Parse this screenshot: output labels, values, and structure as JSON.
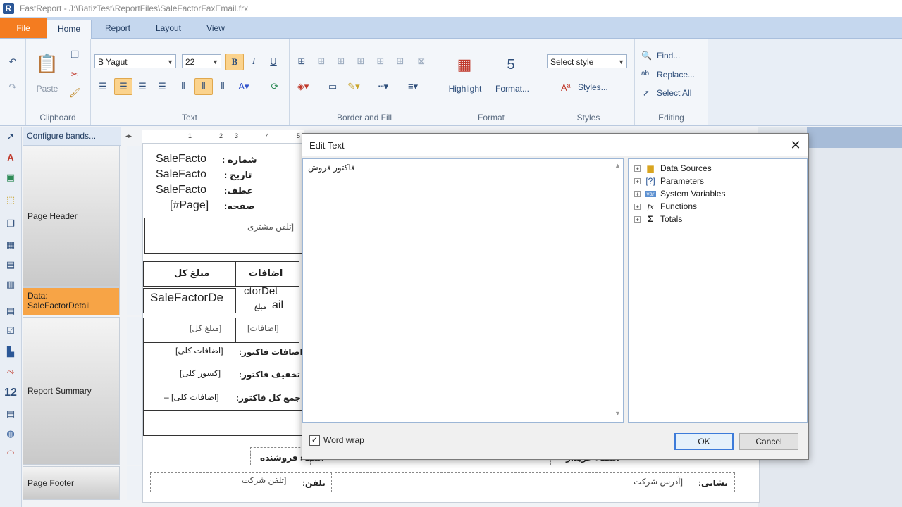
{
  "window": {
    "title": "FastReport - J:\\BatizTest\\ReportFiles\\SaleFactorFaxEmail.frx",
    "app_icon": "R"
  },
  "tabs": [
    {
      "label": "File"
    },
    {
      "label": "Home"
    },
    {
      "label": "Report"
    },
    {
      "label": "Layout"
    },
    {
      "label": "View"
    }
  ],
  "ribbon": {
    "clipboard": {
      "label": "Clipboard",
      "paste": "Paste"
    },
    "text": {
      "label": "Text",
      "font": "B Yagut",
      "size": "22",
      "bold": "B",
      "italic": "I",
      "underline": "U"
    },
    "border": {
      "label": "Border and Fill"
    },
    "format": {
      "label": "Format",
      "highlight": "Highlight",
      "format": "Format..."
    },
    "styles": {
      "label": "Styles",
      "select_style": "Select style",
      "styles": "Styles..."
    },
    "editing": {
      "label": "Editing",
      "find": "Find...",
      "replace": "Replace...",
      "select_all": "Select All"
    }
  },
  "bands": {
    "configure": "Configure bands...",
    "page_header": "Page Header",
    "data": "Data:\nSaleFactorDetail",
    "report_summary": "Report Summary",
    "page_footer": "Page Footer"
  },
  "report": {
    "header_labels": [
      "شماره :",
      "تاریخ :",
      "عطف:",
      "صفحه:"
    ],
    "header_values": [
      "SaleFacto",
      "SaleFacto",
      "SaleFacto",
      "[#Page]"
    ],
    "customer_phone": "[تلفن مشتری",
    "col_total": "مبلغ کل",
    "col_additions": "اضافات",
    "data_field": "SaleFactorDe",
    "data_field2": "ctorDet",
    "data_field3": "ail",
    "data_field4": "مبلغ",
    "sum_total": "[مبلغ کل]",
    "sum_additions": "[اضافات]",
    "factor_additions_label": "اضافات فاکتور:",
    "factor_additions_val": "[اضافات کلی]",
    "factor_discount_label": "تخفیف فاکتور:",
    "factor_discount_val": "[کسور کلی]",
    "factor_total_label": "جمع کل فاکتور:",
    "factor_total_val": "[اضافات کلی] –",
    "seller_sign": "امضاء فروشنده",
    "buyer_sign": "امضاء خریدار",
    "phone_label": "تلفن:",
    "phone_val": "[تلفن شرکت",
    "address_label": "نشانی:",
    "address_val": "[آدرس شرکت"
  },
  "ruler_ticks": [
    "1",
    "2",
    "3",
    "4",
    "5"
  ],
  "dialog": {
    "title": "Edit Text",
    "text": "فاکتور فروش",
    "tree": [
      "Data Sources",
      "Parameters",
      "System Variables",
      "Functions",
      "Totals"
    ],
    "word_wrap": "Word wrap",
    "ok": "OK",
    "cancel": "Cancel"
  },
  "colors": {
    "file_tab": "#f47c20",
    "selected_band": "#f7a446",
    "ok_border": "#3d7bd9"
  }
}
